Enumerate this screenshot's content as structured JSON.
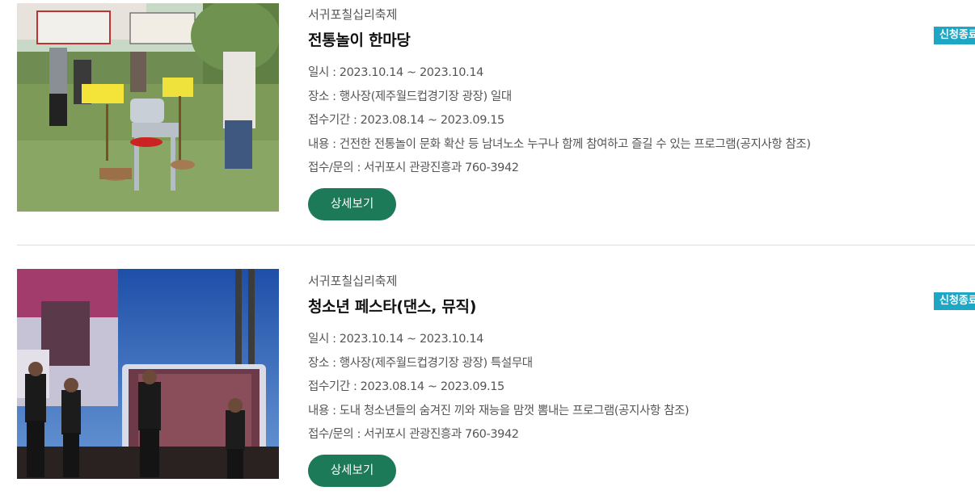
{
  "events": [
    {
      "category": "서귀포칠십리축제",
      "title": "전통놀이 한마당",
      "date": "일시 : 2023.10.14 ~ 2023.10.14",
      "place": "장소 : 행사장(제주월드컵경기장 광장) 일대",
      "period": "접수기간 : 2023.08.14 ~ 2023.09.15",
      "content": "내용 : 건전한 전통놀이 문화 확산 등 남녀노소 누구나 함께 참여하고 즐길 수 있는 프로그램(공지사항 참조)",
      "contact": "접수/문의 : 서귀포시 관광진흥과 760-3942",
      "button": "상세보기",
      "badge": "신청종료"
    },
    {
      "category": "서귀포칠십리축제",
      "title": "청소년 페스타(댄스, 뮤직)",
      "date": "일시 : 2023.10.14 ~ 2023.10.14",
      "place": "장소 : 행사장(제주월드컵경기장 광장) 특설무대",
      "period": "접수기간 : 2023.08.14 ~ 2023.09.15",
      "content": "내용 : 도내 청소년들의 숨겨진 끼와 재능을 맘껏 뽐내는 프로그램(공지사항 참조)",
      "contact": "접수/문의 : 서귀포시 관광진흥과 760-3942",
      "button": "상세보기",
      "badge": "신청종료"
    }
  ],
  "colors": {
    "button": "#1d7a58",
    "badge": "#1ea7c4",
    "divider": "#dddddd"
  }
}
